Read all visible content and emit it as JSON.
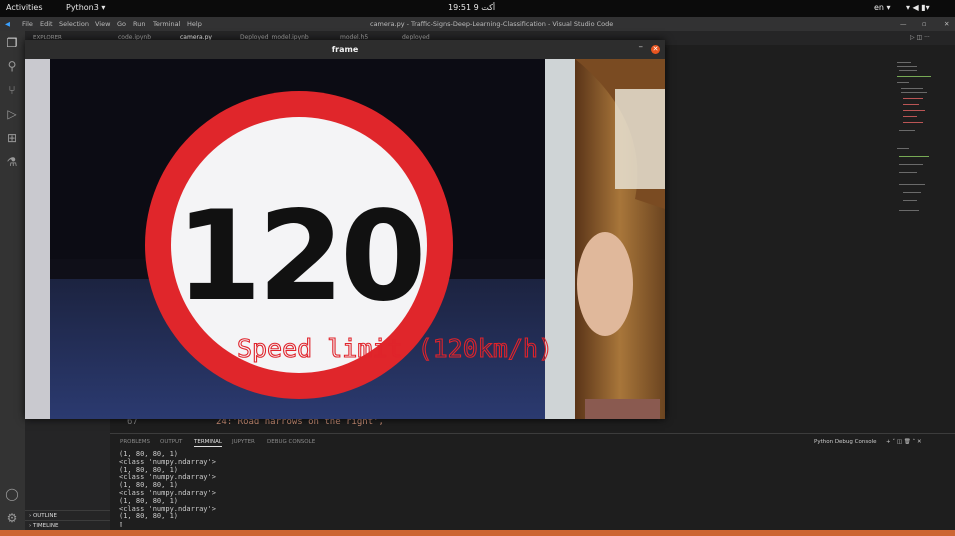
{
  "topbar": {
    "activities": "Activities",
    "app": "Python3 ▾",
    "clock": "أكت 9  19:51",
    "lang": "en ▾"
  },
  "vscode": {
    "menu": [
      "File",
      "Edit",
      "Selection",
      "View",
      "Go",
      "Run",
      "Terminal",
      "Help"
    ],
    "title": "camera.py - Traffic-Signs-Deep-Learning-Classification - Visual Studio Code",
    "explorer": "EXPLORER",
    "tabs": [
      "code.ipynb",
      "camera.py",
      "Deployed_model.ipynb",
      "model.h5",
      "deployed"
    ],
    "code_line_number": "67",
    "code_line_text": "24:'Road narrows on the right',",
    "panel_tabs": [
      "PROBLEMS",
      "OUTPUT",
      "TERMINAL",
      "JUPYTER",
      "DEBUG CONSOLE"
    ],
    "debug_label": "Python Debug Console",
    "terminal": "(1, 80, 80, 1)\n<class 'numpy.ndarray'>\n(1, 80, 80, 1)\n<class 'numpy.ndarray'>\n(1, 80, 80, 1)\n<class 'numpy.ndarray'>\n(1, 80, 80, 1)\n<class 'numpy.ndarray'>\n(1, 80, 80, 1)\n▯",
    "outline": "OUTLINE",
    "timeline": "TIMELINE"
  },
  "frame": {
    "title": "frame",
    "sign_number": "120",
    "prediction": "Speed limit (120km/h)"
  }
}
